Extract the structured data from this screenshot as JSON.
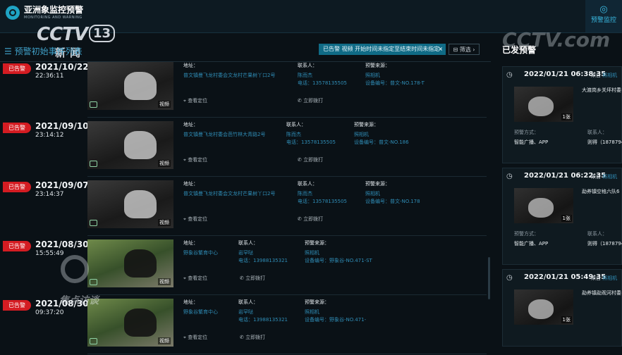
{
  "app": {
    "brand_name": "亚洲象监控预警",
    "brand_sub": "MONITORING AND WARNING",
    "nav_right_label": "预警监控"
  },
  "overlay": {
    "cctv_logo": "CCTV",
    "cctv_channel": "13",
    "cctv_news": "新闻",
    "right_watermark": "CCTV.com",
    "bottom_watermark": "焦点访谈"
  },
  "list_header": {
    "title": "预警初始事件列表",
    "filter_tag": "已告警  视频  开始时间未指定至结束时间未指定",
    "filter_tag_close": "×",
    "filter_button": "筛选",
    "filter_button_chevron": "›"
  },
  "common": {
    "badge": "已告警",
    "video_tag": "视频",
    "address_label": "地址：",
    "contact_label": "联系人：",
    "source_label": "预警来源：",
    "locate_link": "查看定位",
    "dial_link": "立即拨打"
  },
  "alarms": [
    {
      "date": "2021/10/22",
      "time": "22:36:11",
      "address": "普文镇曼飞龙村委会文龙村芒果树丫口2号",
      "contact_name": "陈而杰",
      "contact_phone": "电话：13578135505",
      "source_type": "照相机",
      "source_id": "设备编号：普文-NO.178-T"
    },
    {
      "date": "2021/09/10",
      "time": "23:14:12",
      "address": "普文镇曼飞龙村委会芭竹林大青路2号",
      "contact_name": "陈而杰",
      "contact_phone": "电话：13578135505",
      "source_type": "照相机",
      "source_id": "设备编号：普文-NO.186"
    },
    {
      "date": "2021/09/07",
      "time": "23:14:37",
      "address": "普文镇曼飞龙村委会文龙村芒果树丫口2号",
      "contact_name": "陈而杰",
      "contact_phone": "电话：13578135505",
      "source_type": "照相机",
      "source_id": "设备编号：普文-NO.178"
    },
    {
      "date": "2021/08/30",
      "time": "15:55:49",
      "address": "野象谷繁育中心",
      "contact_name": "岩罕哒",
      "contact_phone": "电话：13988135321",
      "source_type": "照相机",
      "source_id": "设备编号：野象谷-NO.471-ST"
    },
    {
      "date": "2021/08/30",
      "time": "09:37:20",
      "address": "野象谷繁育中心",
      "contact_name": "岩罕哒",
      "contact_phone": "电话：13988135321",
      "source_type": "照相机",
      "source_id": "设备编号：野象谷-NO.471-"
    }
  ],
  "right_panel": {
    "title": "已发预警",
    "cards": [
      {
        "datetime": "2022/01/21 06:38:35",
        "from": "来自",
        "from_source": "照相机",
        "location": "大渡岗乡关坪村委",
        "count": "1张",
        "method_label": "预警方式：",
        "method": "智能广播、APP",
        "contact_label": "联系人：",
        "contact": "则得（1878794"
      },
      {
        "datetime": "2022/01/21 06:22:35",
        "from": "来自",
        "from_source": "照相机",
        "location": "勐养镇空格六队6",
        "count": "1张",
        "method_label": "预警方式：",
        "method": "智能广播、APP",
        "contact_label": "联系人：",
        "contact": "则得（1878794"
      },
      {
        "datetime": "2022/01/21 05:49:35",
        "from": "来自",
        "from_source": "照相机",
        "location": "勐养镇勐观河村委",
        "count": "1张"
      }
    ]
  }
}
